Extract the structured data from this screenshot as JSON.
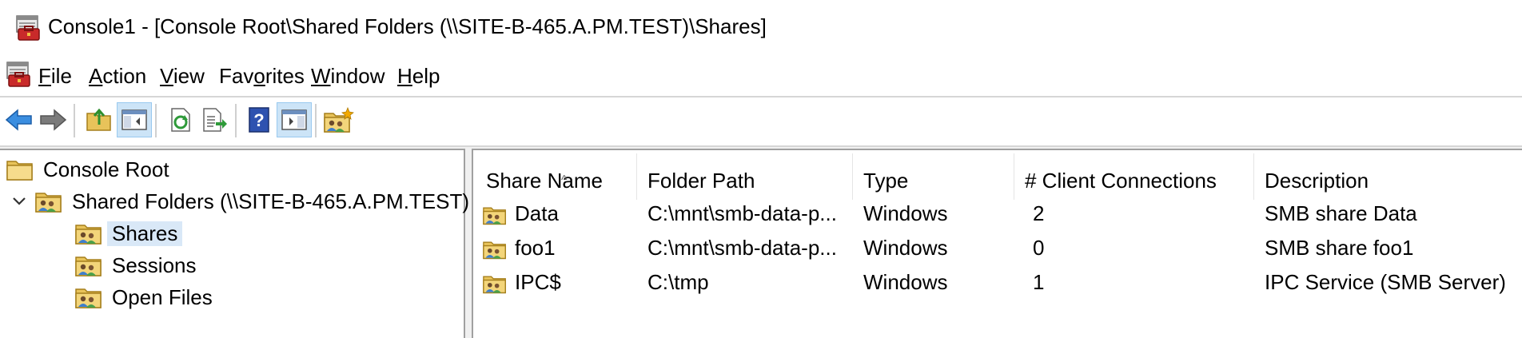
{
  "window": {
    "title": "Console1 - [Console Root\\Shared Folders (\\\\SITE-B-465.A.PM.TEST)\\Shares]"
  },
  "menu": [
    {
      "pre": "",
      "acc": "F",
      "post": "ile"
    },
    {
      "pre": "",
      "acc": "A",
      "post": "ction"
    },
    {
      "pre": "",
      "acc": "V",
      "post": "iew"
    },
    {
      "pre": "Fav",
      "acc": "o",
      "post": "rites"
    },
    {
      "pre": "",
      "acc": "W",
      "post": "indow"
    },
    {
      "pre": "",
      "acc": "H",
      "post": "elp"
    }
  ],
  "toolbar": {
    "buttons": [
      "back-icon",
      "forward-icon",
      "up-folder-icon",
      "show-hide-tree-icon",
      "refresh-icon",
      "export-list-icon",
      "help-icon",
      "show-hide-action-pane-icon",
      "new-share-icon"
    ]
  },
  "tree": {
    "root": "Console Root",
    "shared_folders": "Shared Folders (\\\\SITE-B-465.A.PM.TEST)",
    "shares": "Shares",
    "sessions": "Sessions",
    "open_files": "Open Files"
  },
  "list": {
    "columns": [
      "Share Name",
      "Folder Path",
      "Type",
      "# Client Connections",
      "Description"
    ],
    "rows": [
      [
        "Data",
        "C:\\mnt\\smb-data-p...",
        "Windows",
        "2",
        "SMB share Data"
      ],
      [
        "foo1",
        "C:\\mnt\\smb-data-p...",
        "Windows",
        "0",
        "SMB share foo1"
      ],
      [
        "IPC$",
        "C:\\tmp",
        "Windows",
        "1",
        "IPC Service (SMB Server)"
      ]
    ]
  },
  "colors": {
    "selection": "#d9e8f7",
    "toolbar_pressed": "#cce4f7",
    "pane_border": "#a0a0a0"
  }
}
